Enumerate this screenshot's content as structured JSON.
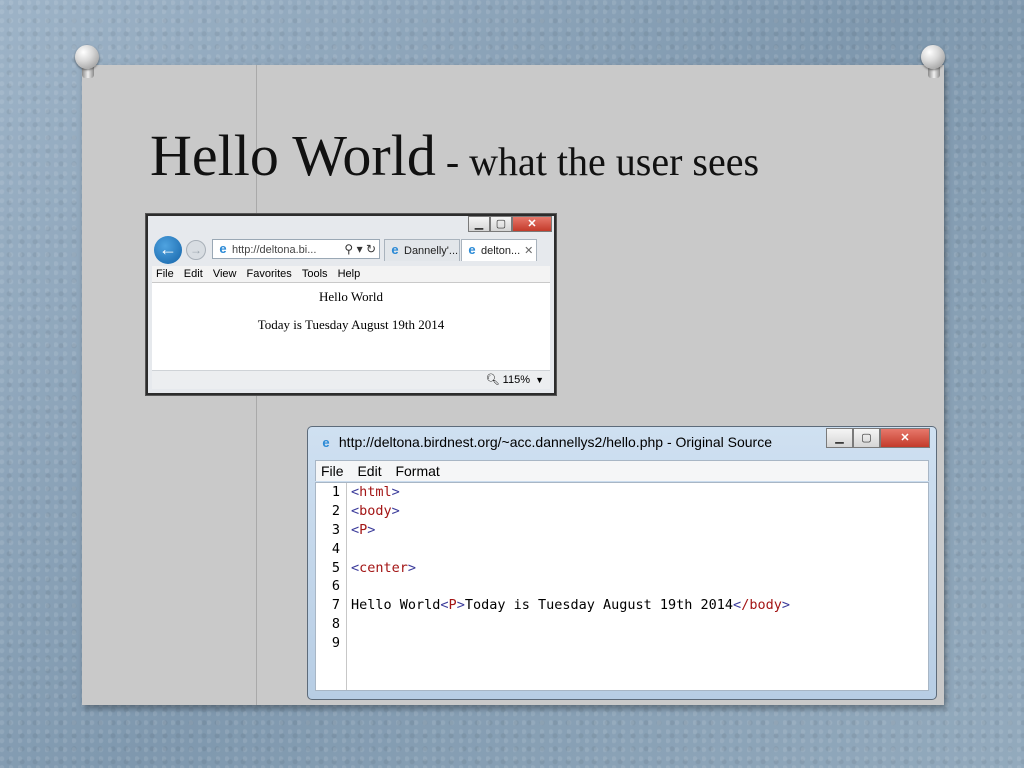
{
  "slide": {
    "title_main": "Hello World",
    "title_sub": " - what the user sees"
  },
  "browser": {
    "address": "http://deltona.bi...",
    "tabs": [
      {
        "label": "Dannelly'...",
        "active": false
      },
      {
        "label": "delton...",
        "active": true
      }
    ],
    "menu": [
      "File",
      "Edit",
      "View",
      "Favorites",
      "Tools",
      "Help"
    ],
    "page_lines": [
      "Hello World",
      "Today is Tuesday August 19th 2014"
    ],
    "zoom": "115%"
  },
  "source_window": {
    "title": "http://deltona.birdnest.org/~acc.dannellys2/hello.php - Original Source",
    "menu": [
      "File",
      "Edit",
      "Format"
    ],
    "line_numbers": [
      "1",
      "2",
      "3",
      "4",
      "5",
      "6",
      "7",
      "8",
      "9"
    ],
    "lines": {
      "l1": "html",
      "l2": "body",
      "l3": "P",
      "l5": "center",
      "l7_text1": "Hello World",
      "l7_tag1": "P",
      "l7_text2": "Today is Tuesday August 19th 2014",
      "l7_tag2": "/body"
    }
  },
  "colors": {
    "background": "#8ea6bb",
    "slide": "#c9c9c9",
    "tag_name": "#a31515",
    "tag_bracket": "#3a3a9a",
    "close_button": "#c33b2b"
  }
}
